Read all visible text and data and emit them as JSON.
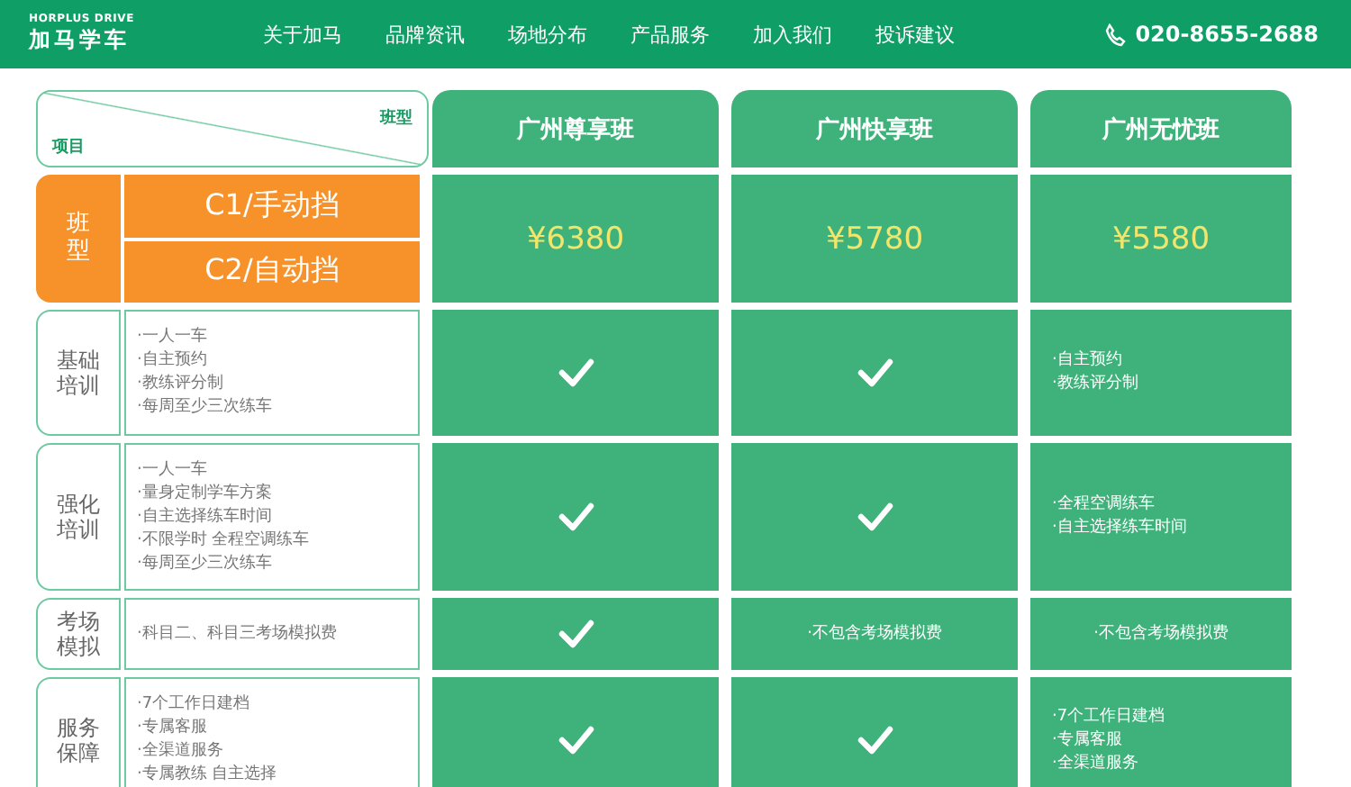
{
  "header": {
    "logo_sub": "HORPLUS DRIVE",
    "logo": "加马学车",
    "nav": [
      "关于加马",
      "品牌资讯",
      "场地分布",
      "产品服务",
      "加入我们",
      "投诉建议"
    ],
    "phone": "020-8655-2688"
  },
  "table": {
    "corner": {
      "top": "班型",
      "bottom": "项目"
    },
    "plans": [
      "广州尊享班",
      "广州快享班",
      "广州无忧班"
    ],
    "price_row": {
      "label": "班型",
      "types": [
        "C1/手动挡",
        "C2/自动挡"
      ],
      "prices": [
        "¥6380",
        "¥5780",
        "¥5580"
      ]
    },
    "rows": [
      {
        "label": "基础培训",
        "items": [
          "·一人一车",
          "·自主预约",
          "·教练评分制",
          "·每周至少三次练车"
        ],
        "cells": [
          {
            "kind": "check"
          },
          {
            "kind": "check"
          },
          {
            "kind": "text",
            "lines": [
              "·自主预约",
              "·教练评分制"
            ]
          }
        ]
      },
      {
        "label": "强化培训",
        "items": [
          "·一人一车",
          "·量身定制学车方案",
          "·自主选择练车时间",
          "·不限学时 全程空调练车",
          "·每周至少三次练车"
        ],
        "cells": [
          {
            "kind": "check"
          },
          {
            "kind": "check"
          },
          {
            "kind": "text",
            "lines": [
              "·全程空调练车",
              "·自主选择练车时间"
            ]
          }
        ]
      },
      {
        "label": "考场模拟",
        "items": [
          "·科目二、科目三考场模拟费"
        ],
        "cells": [
          {
            "kind": "check"
          },
          {
            "kind": "text",
            "lines": [
              "·不包含考场模拟费"
            ]
          },
          {
            "kind": "text",
            "lines": [
              "·不包含考场模拟费"
            ]
          }
        ]
      },
      {
        "label": "服务保障",
        "items": [
          "·7个工作日建档",
          "·专属客服",
          "·全渠道服务",
          "·专属教练 自主选择"
        ],
        "cells": [
          {
            "kind": "check"
          },
          {
            "kind": "check"
          },
          {
            "kind": "text",
            "lines": [
              "·7个工作日建档",
              "·专属客服",
              "·全渠道服务"
            ]
          }
        ]
      }
    ]
  }
}
